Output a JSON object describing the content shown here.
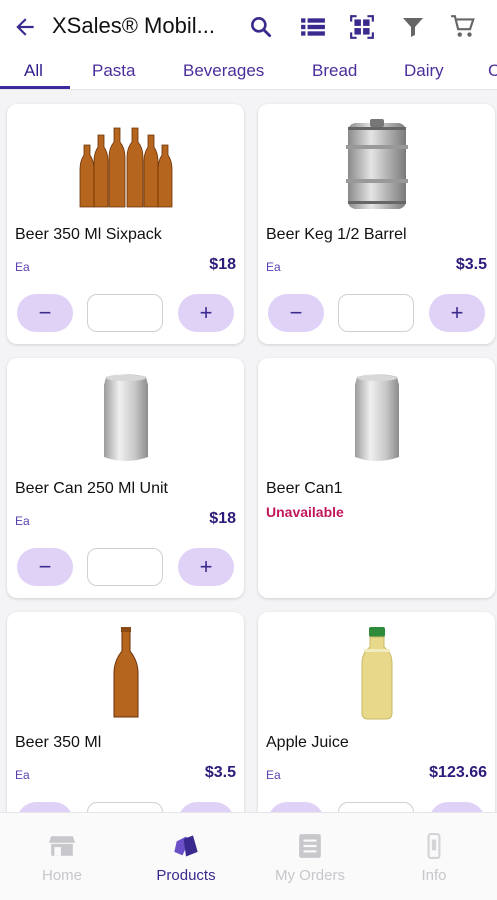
{
  "header": {
    "title": "XSales® Mobil...",
    "icons": [
      "back-arrow-icon",
      "search-icon",
      "list-view-icon",
      "qr-code-icon",
      "filter-icon",
      "cart-icon"
    ]
  },
  "tabs": [
    {
      "label": "All",
      "active": true
    },
    {
      "label": "Pasta",
      "active": false
    },
    {
      "label": "Beverages",
      "active": false
    },
    {
      "label": "Bread",
      "active": false
    },
    {
      "label": "Dairy",
      "active": false
    },
    {
      "label": "C",
      "active": false
    }
  ],
  "products": [
    {
      "name": "Beer 350 Ml Sixpack",
      "unit": "Ea",
      "price": "$18",
      "available": true,
      "image": "beer-sixpack-icon"
    },
    {
      "name": "Beer Keg 1/2 Barrel",
      "unit": "Ea",
      "price": "$3.5",
      "available": true,
      "image": "keg-icon"
    },
    {
      "name": "Beer Can 250 Ml Unit",
      "unit": "Ea",
      "price": "$18",
      "available": true,
      "image": "can-icon"
    },
    {
      "name": "Beer Can1",
      "status": "Unavailable",
      "available": false,
      "image": "can-icon"
    },
    {
      "name": "Beer 350 Ml",
      "unit": "Ea",
      "price": "$3.5",
      "available": true,
      "image": "beer-bottle-icon"
    },
    {
      "name": "Apple Juice",
      "unit": "Ea",
      "price": "$123.66",
      "available": true,
      "image": "juice-bottle-icon"
    }
  ],
  "stepper": {
    "minus": "−",
    "plus": "+",
    "value": ""
  },
  "bottom_nav": [
    {
      "label": "Home",
      "active": false,
      "icon": "store-icon"
    },
    {
      "label": "Products",
      "active": true,
      "icon": "products-icon"
    },
    {
      "label": "My Orders",
      "active": false,
      "icon": "orders-icon"
    },
    {
      "label": "Info",
      "active": false,
      "icon": "info-icon"
    }
  ],
  "colors": {
    "accent": "#3a2a8e",
    "stepper_bg": "#e0d2f7",
    "unavailable": "#c2185b",
    "nav_inactive": "#c7c7cc"
  }
}
